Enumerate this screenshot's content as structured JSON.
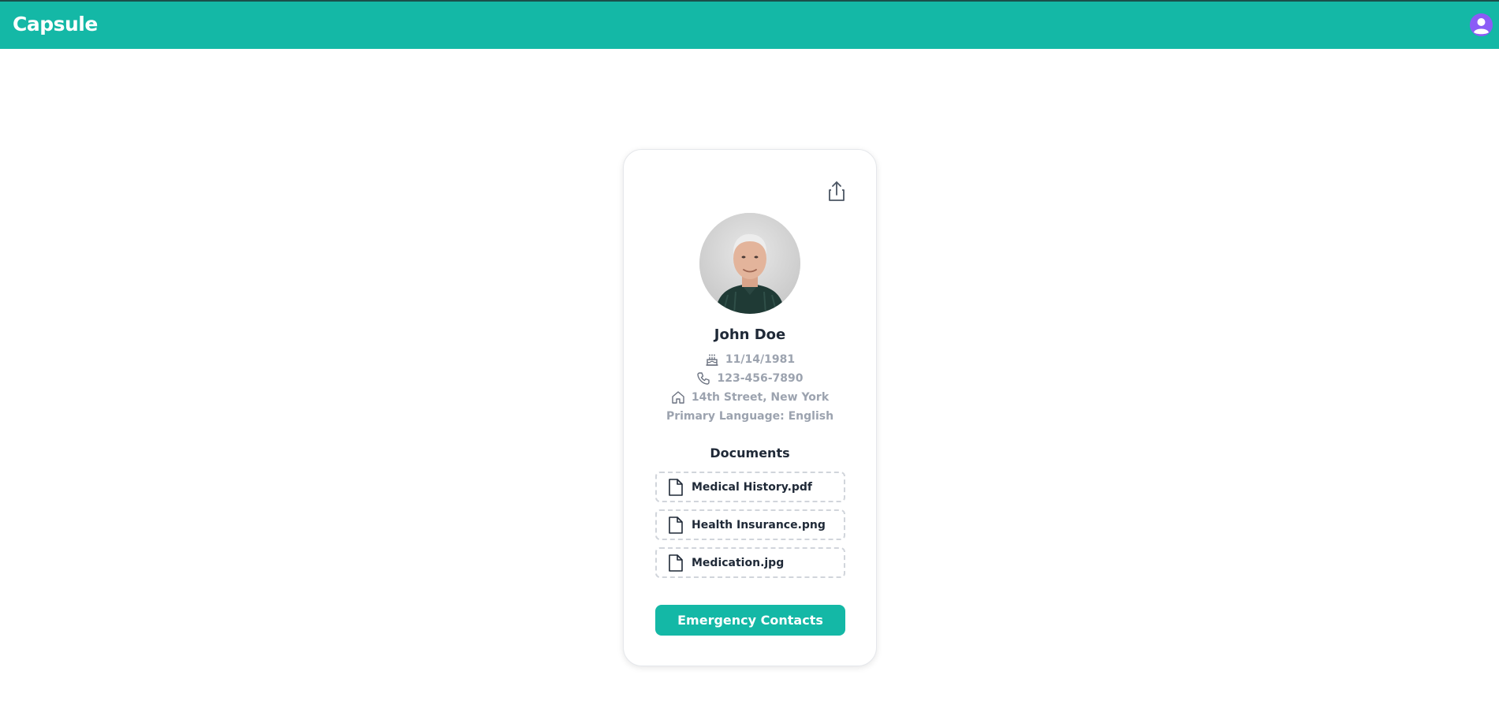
{
  "header": {
    "brand": "Capsule",
    "accent_color": "#14b8a6",
    "user_avatar_icon": "user-circle-icon"
  },
  "profile": {
    "name": "John Doe",
    "birthdate": "11/14/1981",
    "phone": "123-456-7890",
    "address": "14th Street, New York",
    "language": "Primary Language: English",
    "icons": {
      "birthdate": "cake-icon",
      "phone": "phone-icon",
      "address": "home-icon",
      "share": "share-icon"
    }
  },
  "documents": {
    "title": "Documents",
    "items": [
      {
        "label": "Medical History.pdf",
        "icon": "file-icon"
      },
      {
        "label": "Health Insurance.png",
        "icon": "file-icon"
      },
      {
        "label": "Medication.jpg",
        "icon": "file-icon"
      }
    ]
  },
  "actions": {
    "emergency_contacts": "Emergency Contacts"
  }
}
